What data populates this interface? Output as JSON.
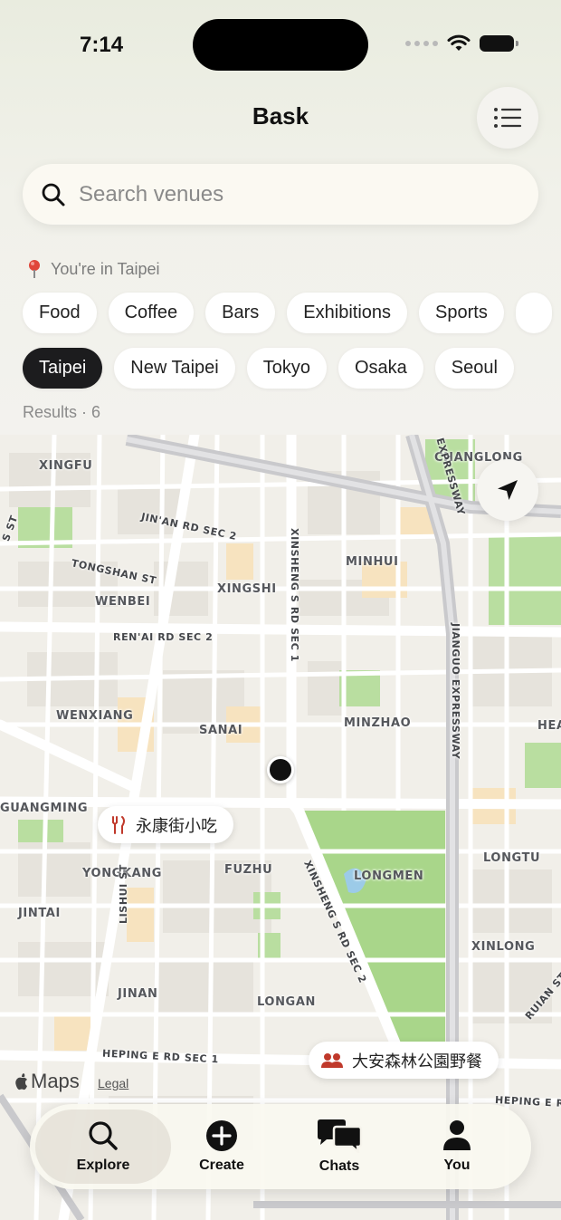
{
  "status_bar": {
    "time": "7:14"
  },
  "header": {
    "title": "Bask"
  },
  "search": {
    "placeholder": "Search venues"
  },
  "location": {
    "text": "You're in Taipei"
  },
  "categories": [
    "Food",
    "Coffee",
    "Bars",
    "Exhibitions",
    "Sports"
  ],
  "cities": {
    "items": [
      "Taipei",
      "New Taipei",
      "Tokyo",
      "Osaka",
      "Seoul"
    ],
    "selected": "Taipei"
  },
  "results": {
    "text": "Results · 6"
  },
  "map": {
    "labels": {
      "xingfu": "XINGFU",
      "changlong": "CHANGLONG",
      "jinan_rd": "JIN'AN RD SEC 2",
      "tongshan": "TONGSHAN ST",
      "wenbei": "WENBEI",
      "xingshi": "XINGSHI",
      "minhui": "MINHUI",
      "renai": "REN'AI RD SEC 2",
      "wenxiang": "WENXIANG",
      "sanai": "SANAI",
      "minzhao": "MINZHAO",
      "guangming": "GUANGMING",
      "yongkang": "YONGKANG",
      "fuzhu": "FUZHU",
      "longmen": "LONGMEN",
      "longtu": "LONGTU",
      "jintai": "JINTAI",
      "lishui": "LISHUI ST",
      "xinlong": "XINLONG",
      "jinan": "JINAN",
      "longan": "LONGAN",
      "heping": "HEPING E RD SEC 1",
      "heping_right": "HEPING E R",
      "xinsheng1": "XINSHENG S RD SEC 1",
      "xinsheng2": "XINSHENG S RD SEC 2",
      "jianguo": "JIANGUO EXPRESSWAY",
      "expressway_top": "EXPRESSWAY",
      "hea": "HEA",
      "ruian": "RUIAN ST",
      "sst": "S ST"
    },
    "pins": [
      {
        "label": "永康街小吃",
        "icon": "fork-knife-icon"
      },
      {
        "label": "大安森林公園野餐",
        "icon": "people-icon"
      }
    ],
    "attribution": {
      "logo": "Maps",
      "legal": "Legal"
    }
  },
  "tabs": [
    {
      "label": "Explore",
      "icon": "magnifier-icon",
      "active": true
    },
    {
      "label": "Create",
      "icon": "plus-circle-icon",
      "active": false
    },
    {
      "label": "Chats",
      "icon": "chat-bubbles-icon",
      "active": false
    },
    {
      "label": "You",
      "icon": "person-icon",
      "active": false
    }
  ],
  "colors": {
    "accent": "#1c1c1e",
    "park": "#a9d68a",
    "pin_icon": "#c0392b"
  }
}
